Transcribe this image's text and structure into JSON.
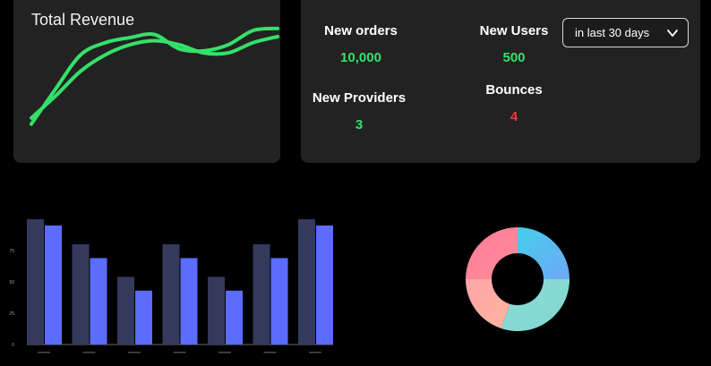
{
  "revenue": {
    "title": "Total Revenue",
    "line_color": "#35e06a",
    "chart_data": {
      "type": "line",
      "title": "Total Revenue",
      "series": [
        {
          "values": [
            10,
            45,
            78,
            90,
            95,
            98,
            84,
            82,
            88,
            102,
            104
          ]
        },
        {
          "values": [
            16,
            38,
            62,
            78,
            88,
            92,
            88,
            80,
            80,
            90,
            96
          ]
        }
      ],
      "ylim": [
        0,
        110
      ]
    }
  },
  "stats": {
    "new_orders": {
      "label": "New orders",
      "value": "10,000"
    },
    "new_users": {
      "label": "New Users",
      "value": "500"
    },
    "new_providers": {
      "label": "New Providers",
      "value": "3"
    },
    "bounces": {
      "label": "Bounces",
      "value": "4"
    },
    "colors": {
      "positive": "#35e06a",
      "negative": "#ee3b3b"
    }
  },
  "period_select": {
    "value": "in last 30 days",
    "icon": "chevron-down-icon"
  },
  "bar_chart": {
    "chart_data": {
      "type": "bar",
      "categories": [
        "",
        "",
        "",
        "",
        "",
        "",
        ""
      ],
      "yticks": [
        "0",
        "25",
        "50",
        "75"
      ],
      "ylim": [
        0,
        100
      ],
      "series": [
        {
          "color": "#343a5c",
          "values": [
            100,
            80,
            54,
            80,
            54,
            80,
            100
          ]
        },
        {
          "color": "#5b6cff",
          "values": [
            95,
            69,
            43,
            69,
            43,
            69,
            95
          ]
        }
      ]
    }
  },
  "donut": {
    "chart_data": {
      "type": "pie",
      "values": [
        25,
        30,
        20,
        25
      ],
      "colors": [
        [
          "#45cfee",
          "#6ea7f4"
        ],
        [
          "#8cdcd0",
          "#7fd8d3"
        ],
        [
          "#ffa6a8",
          "#ffb39e"
        ],
        [
          "#ff7b95",
          "#ff8d9b"
        ]
      ]
    }
  }
}
